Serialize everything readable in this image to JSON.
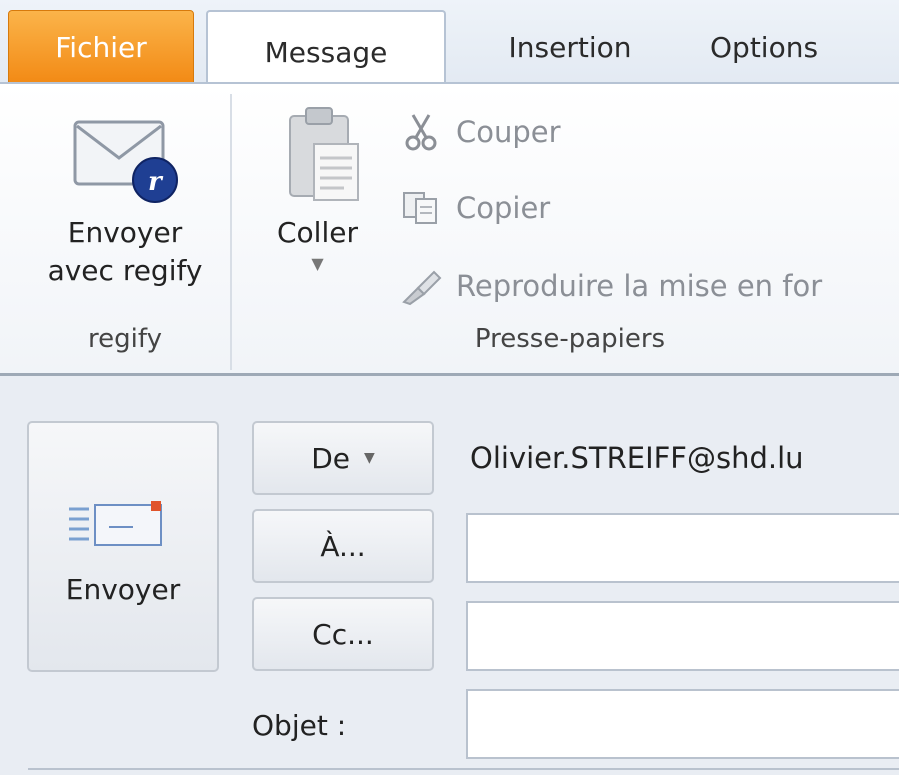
{
  "tabs": {
    "file": "Fichier",
    "message": "Message",
    "insertion": "Insertion",
    "options": "Options"
  },
  "ribbon": {
    "regify": {
      "button_label_line1": "Envoyer",
      "button_label_line2": "avec regify",
      "group_label": "regify"
    },
    "clipboard": {
      "paste_label": "Coller",
      "cut_label": "Couper",
      "copy_label": "Copier",
      "format_painter_label": "Reproduire la mise en for",
      "group_label": "Presse-papiers"
    }
  },
  "compose": {
    "send_label": "Envoyer",
    "from_button": "De",
    "from_value": "Olivier.STREIFF@shd.lu",
    "to_button": "À...",
    "cc_button": "Cc...",
    "subject_label": "Objet :",
    "to_value": "",
    "cc_value": "",
    "subject_value": ""
  },
  "colors": {
    "file_tab": "#f28a15",
    "ribbon_bg": "#ffffff",
    "form_bg": "#e9edf3"
  }
}
